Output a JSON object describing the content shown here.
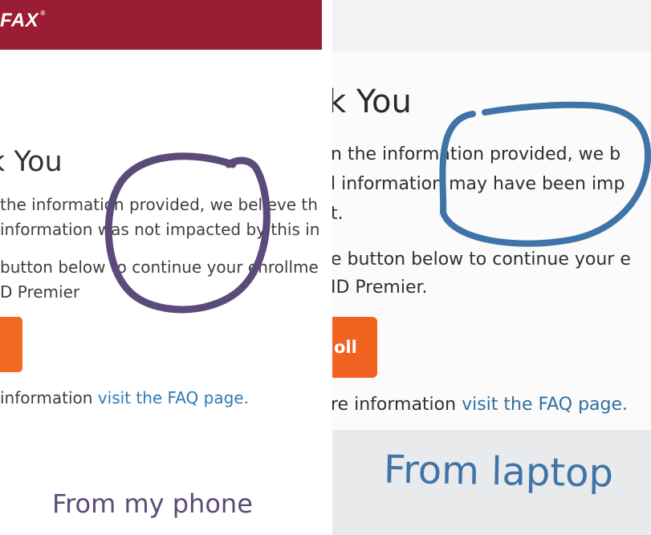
{
  "phone": {
    "logo": "FAX",
    "logo_mark": "®",
    "title": "k You",
    "line1": " the information provided, we believe th",
    "line2": "information was not impacted by this in",
    "line3": "button below to continue your enrollme",
    "line4": "D Premier",
    "faq_prefix": " information ",
    "faq_link": "visit the FAQ page.",
    "caption": "From my phone",
    "annotation_color": "#5b4b7a",
    "header_color": "#9a1d34"
  },
  "laptop": {
    "title": "k You",
    "line1": "n the information provided, we b",
    "line2": "l information may have been imp",
    "line3": "t.",
    "line4": "e button below to continue your e",
    "line5": "ID Premier.",
    "button_label": "oll",
    "faq_prefix": "re information ",
    "faq_link": "visit the FAQ page.",
    "caption": "From laptop",
    "annotation_color": "#3f74a8",
    "button_color": "#f06321"
  }
}
